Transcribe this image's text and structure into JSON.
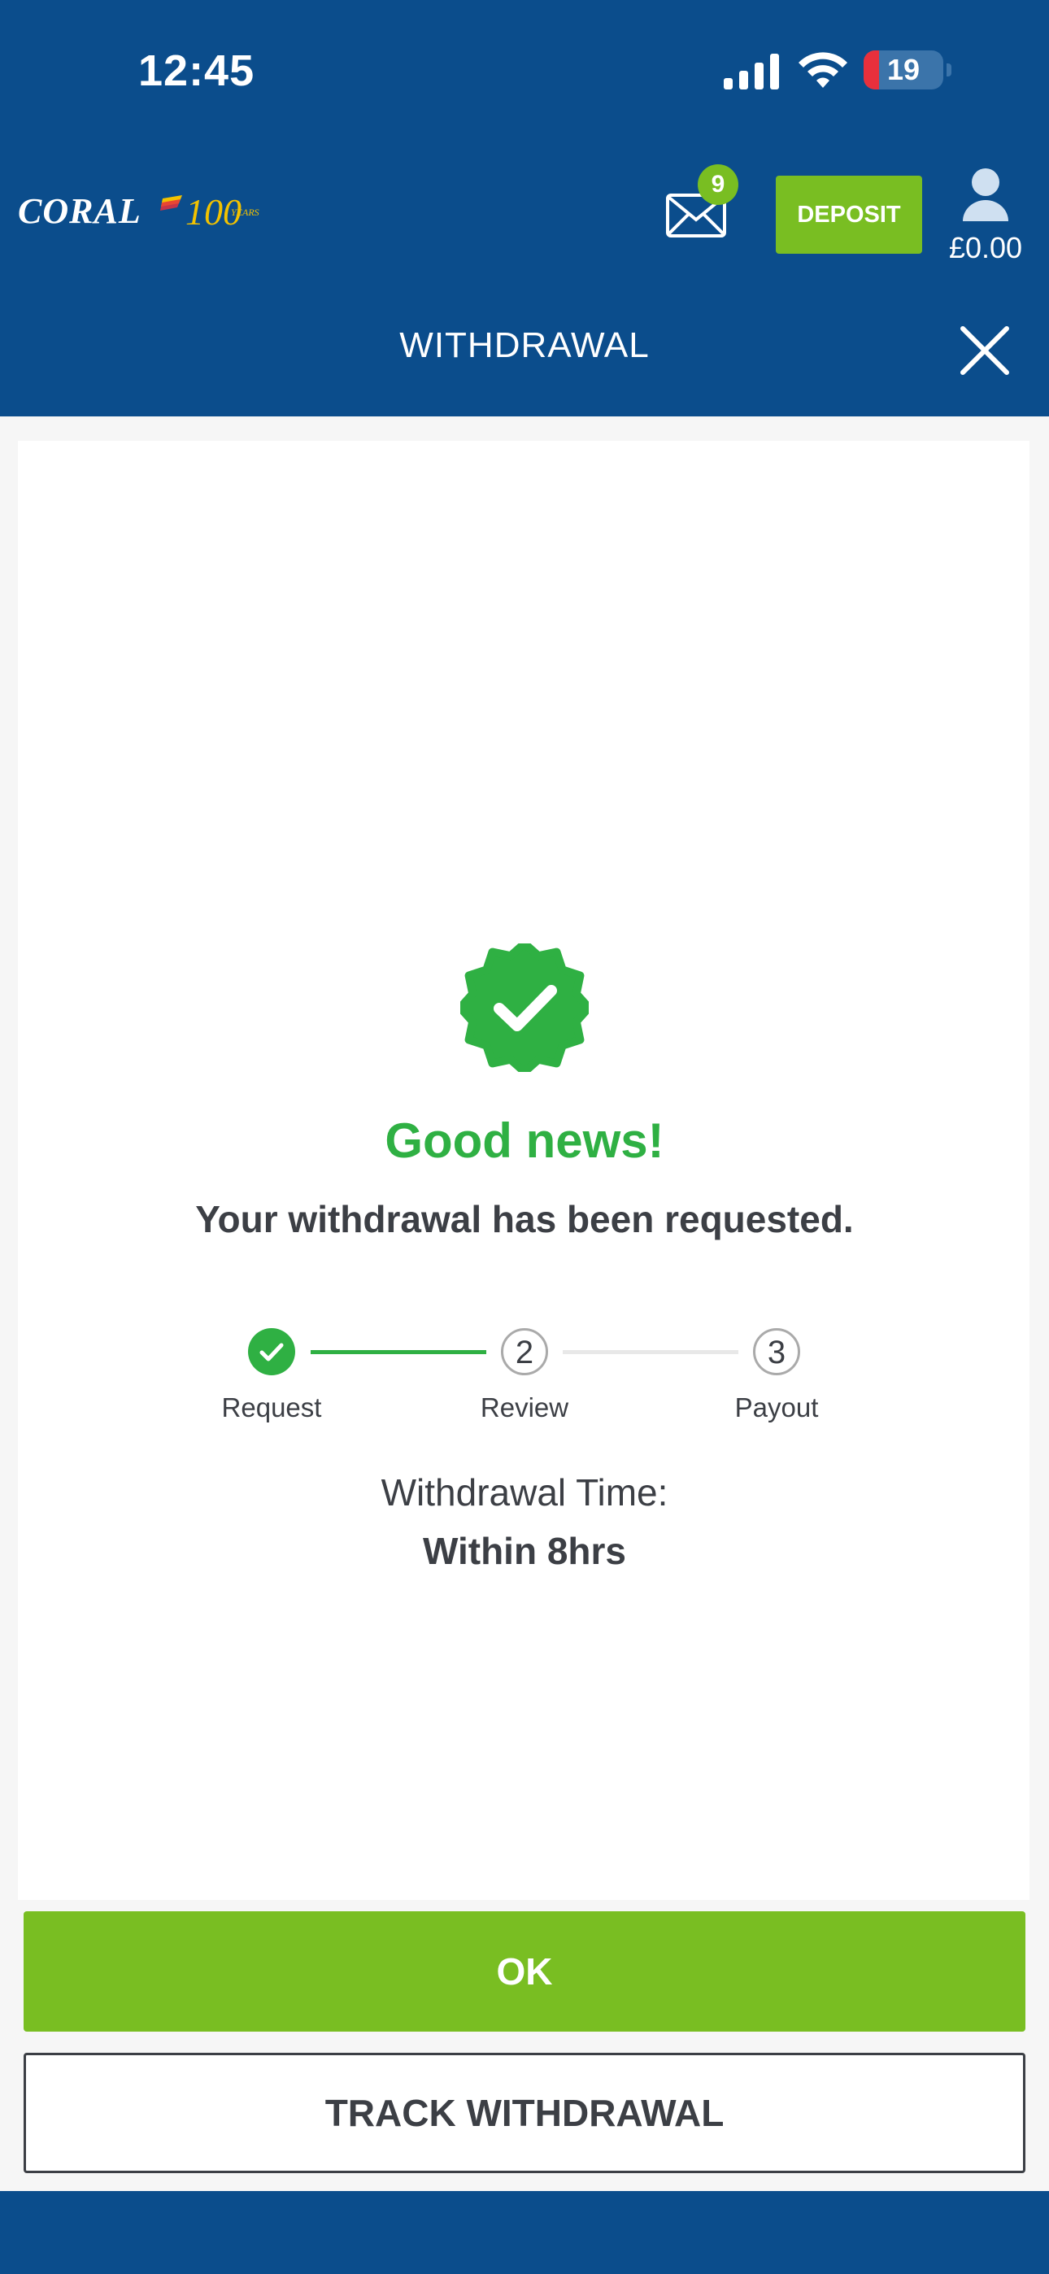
{
  "status_bar": {
    "time": "12:45",
    "battery": "19",
    "battery_level_percent": 19
  },
  "header": {
    "logo_text": "CORAL",
    "logo_anniversary": "100",
    "logo_years": "YEARS",
    "mail_count": "9",
    "deposit_label": "DEPOSIT",
    "balance": "£0.00",
    "page_title": "WITHDRAWAL"
  },
  "confirmation": {
    "title": "Good news!",
    "message": "Your withdrawal has been requested."
  },
  "steps": [
    {
      "number": "",
      "label": "Request",
      "state": "complete"
    },
    {
      "number": "2",
      "label": "Review",
      "state": "pending"
    },
    {
      "number": "3",
      "label": "Payout",
      "state": "pending"
    }
  ],
  "withdrawal_time": {
    "label": "Withdrawal Time:",
    "value": "Within 8hrs"
  },
  "actions": {
    "ok_label": "OK",
    "track_label": "TRACK WITHDRAWAL"
  },
  "colors": {
    "brand_blue": "#0b4d8c",
    "accent_green": "#79be22",
    "success_green": "#2fb043",
    "text_dark": "#3c3f45"
  },
  "icons": [
    "signal-icon",
    "wifi-icon",
    "battery-icon",
    "mail-icon",
    "user-icon",
    "close-icon",
    "verified-badge-icon",
    "checkmark-icon"
  ]
}
